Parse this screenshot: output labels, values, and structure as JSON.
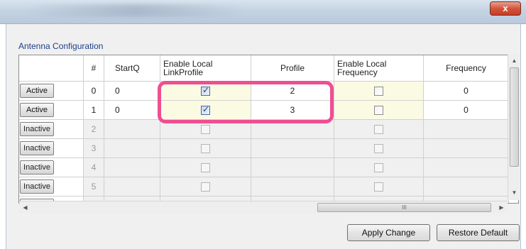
{
  "window": {
    "close_label": "x"
  },
  "group": {
    "title": "Antenna Configuration"
  },
  "grid": {
    "headers": {
      "number": "#",
      "startq": "StartQ",
      "enable_local_linkprofile": "Enable Local LinkProfile",
      "profile": "Profile",
      "enable_local_frequency": "Enable Local Frequency",
      "frequency": "Frequency"
    },
    "rows": [
      {
        "state": "Active",
        "number": "0",
        "startq": "0",
        "linkprofile_enabled": true,
        "profile": "2",
        "frequency_enabled": false,
        "frequency": "0"
      },
      {
        "state": "Active",
        "number": "1",
        "startq": "0",
        "linkprofile_enabled": true,
        "profile": "3",
        "frequency_enabled": false,
        "frequency": "0"
      },
      {
        "state": "Inactive",
        "number": "2",
        "startq": "",
        "linkprofile_enabled": false,
        "profile": "",
        "frequency_enabled": false,
        "frequency": ""
      },
      {
        "state": "Inactive",
        "number": "3",
        "startq": "",
        "linkprofile_enabled": false,
        "profile": "",
        "frequency_enabled": false,
        "frequency": ""
      },
      {
        "state": "Inactive",
        "number": "4",
        "startq": "",
        "linkprofile_enabled": false,
        "profile": "",
        "frequency_enabled": false,
        "frequency": ""
      },
      {
        "state": "Inactive",
        "number": "5",
        "startq": "",
        "linkprofile_enabled": false,
        "profile": "",
        "frequency_enabled": false,
        "frequency": ""
      }
    ]
  },
  "scrollbar": {
    "up_arrow": "▲",
    "down_arrow": "▼",
    "left_arrow": "◀",
    "right_arrow": "▶",
    "thumb_grip": "III"
  },
  "buttons": {
    "apply": "Apply Change",
    "restore": "Restore Default"
  },
  "colors": {
    "highlight": "#ef4e93",
    "enabled_cell": "#fbfbe4",
    "group_title": "#1e3f8a"
  }
}
